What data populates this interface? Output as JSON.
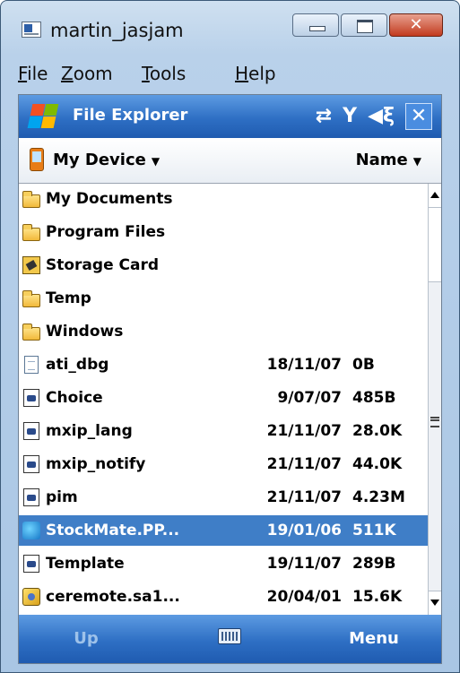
{
  "window": {
    "title": "martin_jasjam",
    "close_glyph": "✕"
  },
  "menu": [
    "File",
    "Zoom",
    "Tools",
    "Help"
  ],
  "titlebar": {
    "app_title": "File Explorer",
    "icons": [
      "sync-icon",
      "signal-icon",
      "speaker-icon",
      "close-icon"
    ],
    "close_glyph": "✕",
    "speaker_glyph": "◀ξ",
    "sync_glyph": "⇄",
    "signal_glyph": "Y"
  },
  "nav": {
    "folder": "My Device",
    "sort": "Name"
  },
  "files": [
    {
      "name": "My Documents",
      "date": "",
      "size": "",
      "icon": "folder"
    },
    {
      "name": "Program Files",
      "date": "",
      "size": "",
      "icon": "folder"
    },
    {
      "name": "Storage Card",
      "date": "",
      "size": "",
      "icon": "storage-card"
    },
    {
      "name": "Temp",
      "date": "",
      "size": "",
      "icon": "folder"
    },
    {
      "name": "Windows",
      "date": "",
      "size": "",
      "icon": "folder"
    },
    {
      "name": "ati_dbg",
      "date": "18/11/07",
      "size": "0B",
      "icon": "document"
    },
    {
      "name": "Choice",
      "date": "9/07/07",
      "size": "485B",
      "icon": "executable"
    },
    {
      "name": "mxip_lang",
      "date": "21/11/07",
      "size": "28.0K",
      "icon": "executable"
    },
    {
      "name": "mxip_notify",
      "date": "21/11/07",
      "size": "44.0K",
      "icon": "executable"
    },
    {
      "name": "pim",
      "date": "21/11/07",
      "size": "4.23M",
      "icon": "executable"
    },
    {
      "name": "StockMate.PP...",
      "date": "19/01/06",
      "size": "511K",
      "icon": "application",
      "selected": true
    },
    {
      "name": "Template",
      "date": "19/11/07",
      "size": "289B",
      "icon": "executable"
    },
    {
      "name": "ceremote.sa1...",
      "date": "20/04/01",
      "size": "15.6K",
      "icon": "cab-file"
    }
  ],
  "softkeys": {
    "left": "Up",
    "right": "Menu"
  },
  "colors": {
    "titlebar": "#2e6fc4",
    "selection": "#3f7ec7",
    "softkey_disabled": "#9ec2ea"
  }
}
